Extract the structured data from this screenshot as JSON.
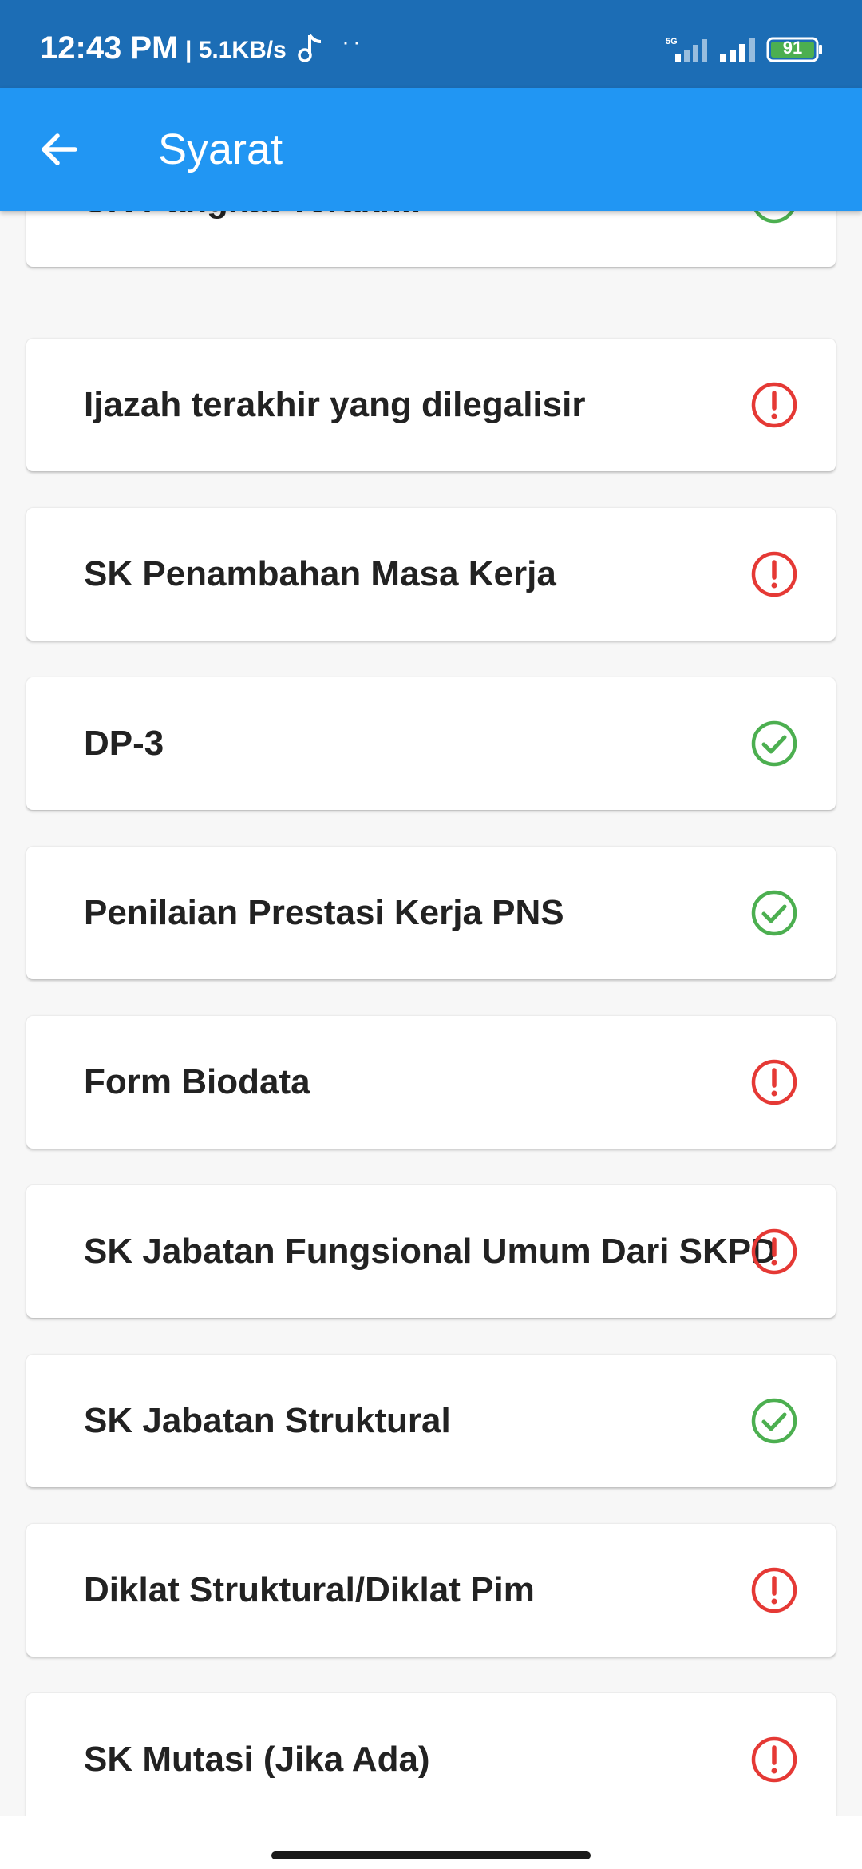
{
  "status_bar": {
    "time": "12:43 PM",
    "speed": "| 5.1KB/s",
    "dots": "··",
    "network_badge": "5G",
    "battery": "91"
  },
  "app_bar": {
    "title": "Syarat"
  },
  "colors": {
    "status_bar_bg": "#1c6db5",
    "app_bar_bg": "#2196f3",
    "complete": "#4caf50",
    "missing": "#e53935",
    "battery_fill": "#4caf50"
  },
  "items": [
    {
      "label": "SK Pangkat Terakhir",
      "status": "complete",
      "icon": "check-circle-icon"
    },
    {
      "label": "Ijazah terakhir yang dilegalisir",
      "status": "missing",
      "icon": "alert-circle-icon"
    },
    {
      "label": "SK Penambahan Masa Kerja",
      "status": "missing",
      "icon": "alert-circle-icon"
    },
    {
      "label": "DP-3",
      "status": "complete",
      "icon": "check-circle-icon"
    },
    {
      "label": "Penilaian Prestasi Kerja PNS",
      "status": "complete",
      "icon": "check-circle-icon"
    },
    {
      "label": "Form Biodata",
      "status": "missing",
      "icon": "alert-circle-icon"
    },
    {
      "label": "SK Jabatan Fungsional Umum Dari SKPD",
      "status": "missing",
      "icon": "alert-circle-icon"
    },
    {
      "label": "SK Jabatan Struktural",
      "status": "complete",
      "icon": "check-circle-icon"
    },
    {
      "label": "Diklat Struktural/Diklat Pim",
      "status": "missing",
      "icon": "alert-circle-icon"
    },
    {
      "label": "SK Mutasi (Jika Ada)",
      "status": "missing",
      "icon": "alert-circle-icon"
    }
  ]
}
